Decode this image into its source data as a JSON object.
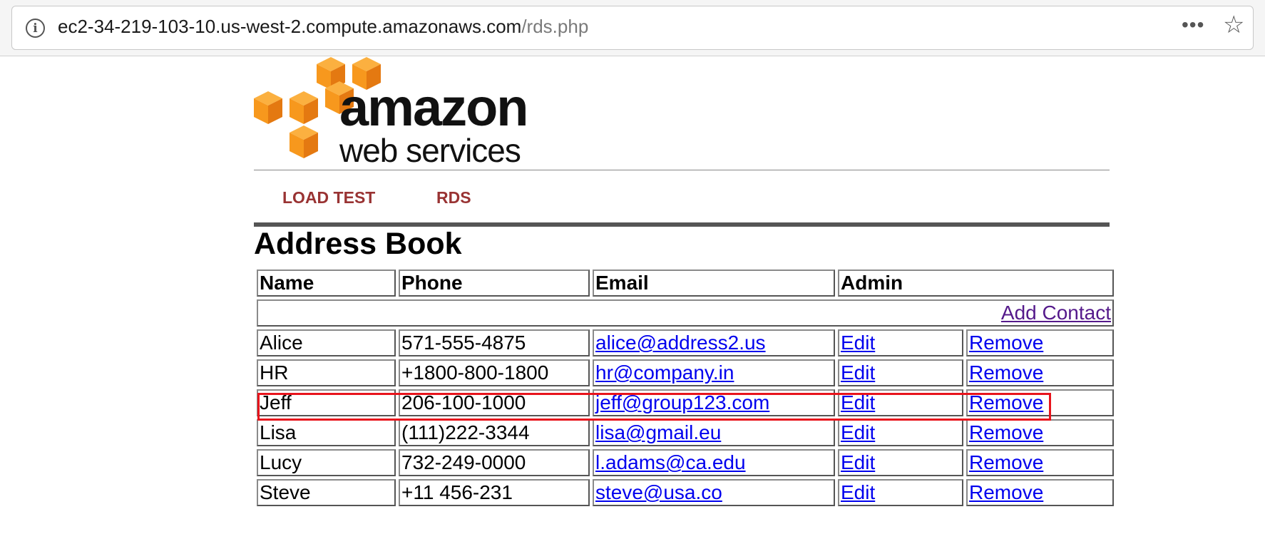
{
  "browser": {
    "url_host": "ec2-34-219-103-10.us-west-2.compute.amazonaws.com",
    "url_path": "/rds.php",
    "more_glyph": "•••",
    "star_glyph": "☆"
  },
  "logo": {
    "line1": "amazon",
    "line2": "web services",
    "cube_color": "#f7981d"
  },
  "nav": {
    "items": [
      {
        "label": "LOAD TEST"
      },
      {
        "label": "RDS"
      }
    ],
    "color": "#993333"
  },
  "page_title": "Address Book",
  "table": {
    "headers": {
      "name": "Name",
      "phone": "Phone",
      "email": "Email",
      "admin": "Admin"
    },
    "add_contact": "Add Contact",
    "rows": [
      {
        "name": "Alice",
        "phone": "571-555-4875",
        "email": "alice@address2.us",
        "edit": "Edit",
        "remove": "Remove"
      },
      {
        "name": "HR",
        "phone": "+1800-800-1800",
        "email": "hr@company.in",
        "edit": "Edit",
        "remove": "Remove"
      },
      {
        "name": "Jeff",
        "phone": "206-100-1000",
        "email": "jeff@group123.com",
        "edit": "Edit",
        "remove": "Remove"
      },
      {
        "name": "Lisa",
        "phone": "(111)222-3344",
        "email": "lisa@gmail.eu",
        "edit": "Edit",
        "remove": "Remove"
      },
      {
        "name": "Lucy",
        "phone": "732-249-0000",
        "email": "l.adams@ca.edu",
        "edit": "Edit",
        "remove": "Remove"
      },
      {
        "name": "Steve",
        "phone": "+11 456-231",
        "email": "steve@usa.co",
        "edit": "Edit",
        "remove": "Remove"
      }
    ]
  },
  "highlight_color": "#e8141c"
}
